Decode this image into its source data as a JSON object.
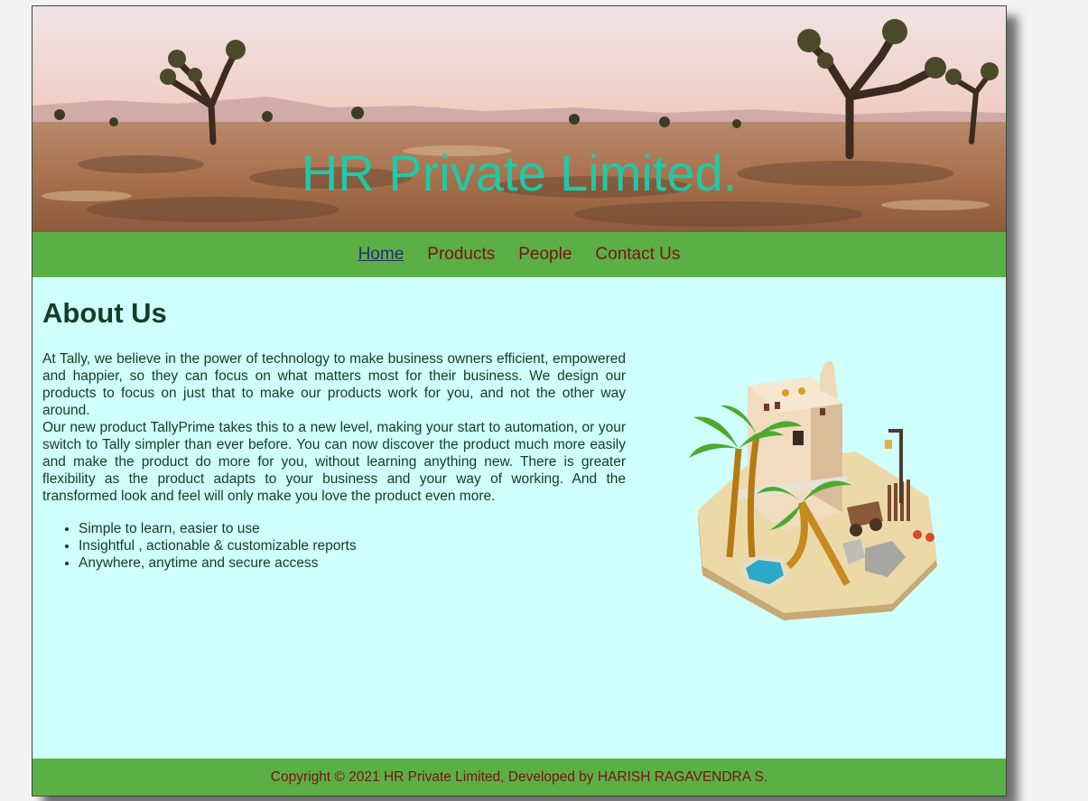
{
  "header": {
    "title": "HR Private Limited."
  },
  "nav": {
    "items": [
      {
        "label": "Home",
        "active": true
      },
      {
        "label": "Products",
        "active": false
      },
      {
        "label": "People",
        "active": false
      },
      {
        "label": "Contact Us",
        "active": false
      }
    ]
  },
  "about": {
    "heading": "About Us",
    "paragraph1": "At Tally, we believe in the power of technology to make business owners efficient, empowered and happier, so they can focus on what matters most for their business. We design our products to focus on just that to make our products work for you, and not the other way around.",
    "paragraph2": "Our new product TallyPrime takes this to a new level, making your start to automation, or your switch to Tally simpler than ever before. You can now discover the product much more easily and make the product do more for you, without learning anything new. There is greater flexibility as the product adapts to your business and your way of working. And the transformed look and feel will only make you love the product even more.",
    "features": [
      "Simple to learn, easier to use",
      "Insightful , actionable & customizable reports",
      "Anywhere, anytime and secure access"
    ]
  },
  "footer": {
    "text": "Copyright © 2021 HR Private Limited, Developed by HARISH RAGAVENDRA S."
  },
  "colors": {
    "nav_background": "#5ab045",
    "content_background": "#cffffb",
    "title_color": "#1fc9a6",
    "link_color": "#7a1313",
    "active_link_color": "#2c2a6e"
  }
}
